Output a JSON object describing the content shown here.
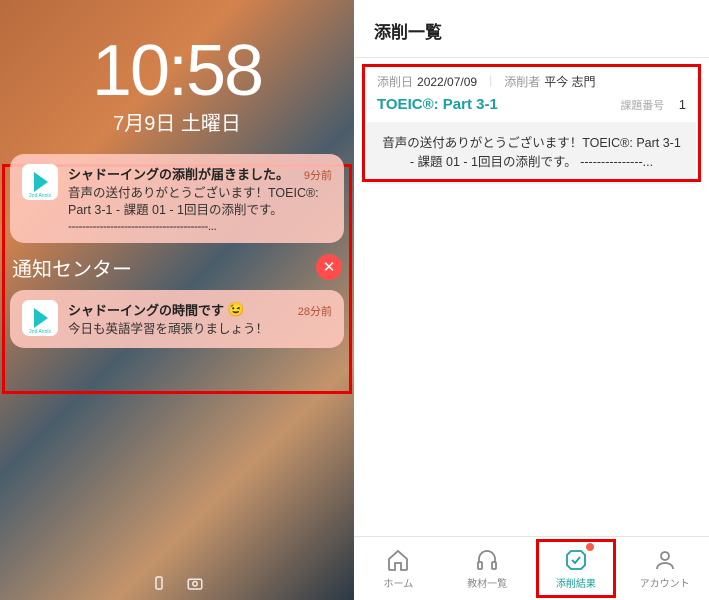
{
  "lockscreen": {
    "time": "10:58",
    "date": "7月9日 土曜日",
    "notifications": [
      {
        "app_sub": "2nd Annix",
        "title": "シャドーイングの添削が届きました。",
        "ago": "9分前",
        "message": "音声の送付ありがとうございます！TOEIC®: Part 3-1 - 課題 01 - 1回目の添削です。",
        "dots": "----------------------------------------..."
      },
      {
        "app_sub": "2nd Annix",
        "title": "シャドーイングの時間です",
        "emoji": "😉",
        "ago": "28分前",
        "message": "今日も英語学習を頑張りましょう！"
      }
    ],
    "center_label": "通知センター"
  },
  "app": {
    "header_title": "添削一覧",
    "card": {
      "date_label": "添削日",
      "date_value": "2022/07/09",
      "reviewer_label": "添削者",
      "reviewer_value": "平今 志門",
      "title": "TOEIC®: Part 3-1",
      "task_num_label": "課題番号",
      "task_num": "1",
      "body": "音声の送付ありがとうございます！TOEIC®: Part 3-1 - 課題 01 - 1回目の添削です。 ---------------..."
    },
    "tabs": {
      "home": "ホーム",
      "materials": "教材一覧",
      "results": "添削結果",
      "account": "アカウント"
    }
  }
}
